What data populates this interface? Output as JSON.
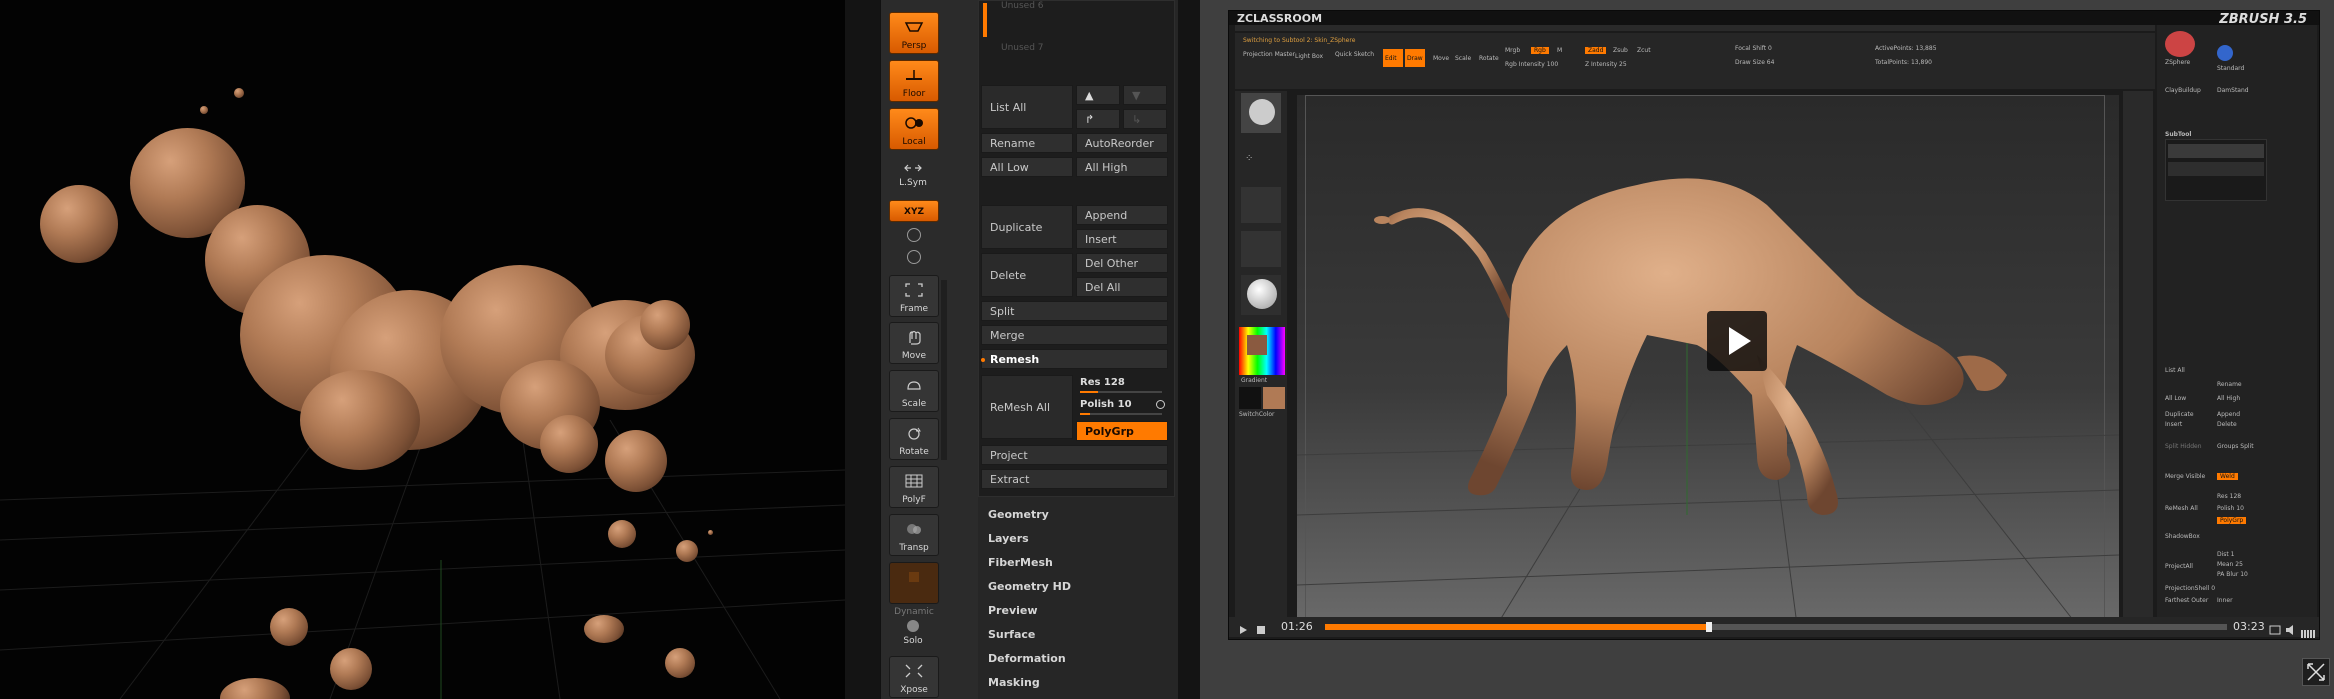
{
  "toolbar": {
    "buttons": [
      {
        "label": "Persp",
        "icon": "perspective-icon",
        "active": true
      },
      {
        "label": "Floor",
        "icon": "floor-icon",
        "active": true
      },
      {
        "label": "Local",
        "icon": "local-icon",
        "active": true
      },
      {
        "label": "L.Sym",
        "icon": "symmetry-icon",
        "active": false
      },
      {
        "label": "XYZ",
        "icon": "xyz-icon",
        "active": true
      },
      {
        "label": "Frame",
        "icon": "frame-icon",
        "active": false
      },
      {
        "label": "Move",
        "icon": "move-icon",
        "active": false
      },
      {
        "label": "Scale",
        "icon": "scale-icon",
        "active": false
      },
      {
        "label": "Rotate",
        "icon": "rotate-icon",
        "active": false
      },
      {
        "label": "PolyF",
        "icon": "polyframe-icon",
        "active": false
      },
      {
        "label": "Transp",
        "icon": "transparency-icon",
        "active": false
      },
      {
        "label": "Dynamic",
        "icon": "dynamic-icon",
        "active": false
      },
      {
        "label": "Solo",
        "icon": "solo-icon",
        "active": false
      },
      {
        "label": "Xpose",
        "icon": "xpose-icon",
        "active": false
      }
    ]
  },
  "subtool_panel": {
    "list_items": [
      "Unused 6",
      "Unused 7"
    ],
    "list_all": "List All",
    "rename": "Rename",
    "autoreorder": "AutoReorder",
    "all_low": "All Low",
    "all_high": "All High",
    "duplicate": "Duplicate",
    "append": "Append",
    "insert": "Insert",
    "delete": "Delete",
    "del_other": "Del Other",
    "del_all": "Del All",
    "split": "Split",
    "merge": "Merge",
    "remesh": "Remesh",
    "remesh_all": "ReMesh All",
    "res_label": "Res 128",
    "polish_label": "Polish 10",
    "res_value": 128,
    "polish_value": 10,
    "polygrp": "PolyGrp",
    "project": "Project",
    "extract": "Extract"
  },
  "tool_sections": [
    "Geometry",
    "Layers",
    "FiberMesh",
    "Geometry HD",
    "Preview",
    "Surface",
    "Deformation",
    "Masking"
  ],
  "video": {
    "brand_left": "ZCLASSROOM",
    "brand_right": "ZBRUSH 3.5",
    "current_time": "01:26",
    "total_time": "03:23",
    "progress": 0.426,
    "inner_status": "Switching to Subtool 2: Skin_ZSphere",
    "inner_labels": {
      "projection_master": "Projection Master",
      "lightbox": "Light Box",
      "quick_sketch": "Quick Sketch",
      "edit": "Edit",
      "draw": "Draw",
      "move": "Move",
      "scale": "Scale",
      "rotate": "Rotate",
      "mrgb": "Mrgb",
      "rgb": "Rgb",
      "m": "M",
      "zadd": "Zadd",
      "zsub": "Zsub",
      "zcut": "Zcut",
      "focal_shift": "Focal Shift 0",
      "draw_size": "Draw Size 64",
      "active_points": "ActivePoints: 13,885",
      "total_points": "TotalPoints: 13,890",
      "rgb_intensity": "Rgb Intensity 100",
      "z_intensity": "Z Intensity 25",
      "gradient": "Gradient",
      "switch_color": "SwitchColor"
    },
    "inner_right_panel": {
      "subtool": "SubTool",
      "list_all": "List All",
      "rename": "Rename",
      "all_low": "All Low",
      "all_high": "All High",
      "duplicate": "Duplicate",
      "append": "Append",
      "insert": "Insert",
      "delete": "Delete",
      "split_hidden": "Split Hidden",
      "groups_split": "Groups Split",
      "merge_visible": "Merge Visible",
      "weld": "Weld",
      "remesh_all": "ReMesh All",
      "res": "Res 128",
      "polish": "Polish 10",
      "polygrp": "PolyGrp",
      "shadowbox": "ShadowBox",
      "projectall": "ProjectAll",
      "dist": "Dist 1",
      "mean": "Mean 25",
      "pa_blur": "PA Blur 10",
      "project_shell": "ProjectionShell 0",
      "farthest": "Farthest Outer",
      "inner": "Inner",
      "brushes": [
        "ZSphere",
        "Standard",
        "ClayBuildup",
        "DamStandard"
      ],
      "brush_labels": [
        "ZSphere",
        "Standard",
        "ClayBuildup",
        "DamStand"
      ]
    }
  },
  "colors": {
    "accent": "#ff7a00",
    "clay": "#b07a55",
    "panel": "#262626"
  }
}
